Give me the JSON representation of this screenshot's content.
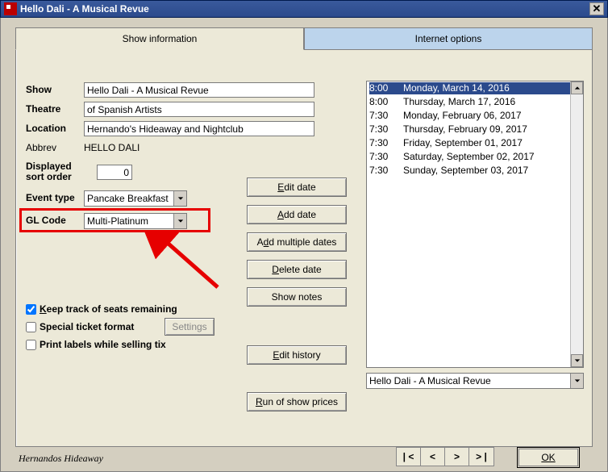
{
  "window": {
    "title": "Hello Dali - A Musical Revue"
  },
  "tabs": {
    "info": "Show information",
    "internet": "Internet options"
  },
  "labels": {
    "show": "Show",
    "theatre": "Theatre",
    "location": "Location",
    "abbrev": "Abbrev",
    "sort": "Displayed sort order",
    "eventtype": "Event type",
    "glcode": "GL Code"
  },
  "fields": {
    "show": "Hello Dali - A Musical Revue",
    "theatre": "of Spanish Artists",
    "location": "Hernando's Hideaway and Nightclub",
    "abbrev": "HELLO DALI",
    "sort": "0",
    "eventtype": "Pancake Breakfast",
    "glcode": "Multi-Platinum"
  },
  "checks": {
    "keep": "Keep track of seats remaining",
    "special": "Special ticket format",
    "print": "Print labels while selling tix",
    "settings": "Settings"
  },
  "btns": {
    "editdate": "Edit date",
    "adddate": "Add date",
    "addmulti": "Add multiple dates",
    "deletedate": "Delete date",
    "shownotes": "Show notes",
    "edithistory": "Edit history",
    "runprices": "Run of show prices"
  },
  "dates": [
    {
      "time": "8:00",
      "day": "Monday, March 14, 2016",
      "sel": true
    },
    {
      "time": "8:00",
      "day": "Thursday, March 17, 2016"
    },
    {
      "time": "7:30",
      "day": "Monday, February 06, 2017"
    },
    {
      "time": "7:30",
      "day": "Thursday, February 09, 2017"
    },
    {
      "time": "7:30",
      "day": "Friday, September 01, 2017"
    },
    {
      "time": "7:30",
      "day": "Saturday, September 02, 2017"
    },
    {
      "time": "7:30",
      "day": "Sunday, September 03, 2017"
    }
  ],
  "showselect": "Hello Dali - A Musical Revue",
  "nav": {
    "first": "| <",
    "prev": "<",
    "next": ">",
    "last": "> |",
    "ok": "OK"
  },
  "status": "Hernandos Hideaway"
}
